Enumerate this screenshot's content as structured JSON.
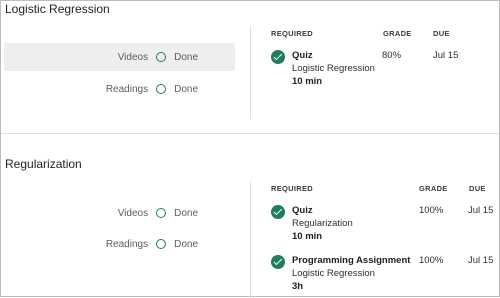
{
  "modules": [
    {
      "title": "Logistic Regression",
      "rows": [
        {
          "label": "Videos",
          "status": "Done",
          "highlight": true
        },
        {
          "label": "Readings",
          "status": "Done",
          "highlight": false
        }
      ],
      "headers": {
        "required": "REQUIRED",
        "grade": "GRADE",
        "due": "DUE"
      },
      "items": [
        {
          "title": "Quiz",
          "subtitle": "Logistic Regression",
          "duration": "10 min",
          "grade": "80%",
          "due": "Jul 15",
          "icon": "check-circle-icon"
        }
      ]
    },
    {
      "title": "Regularization",
      "rows": [
        {
          "label": "Videos",
          "status": "Done",
          "highlight": false
        },
        {
          "label": "Readings",
          "status": "Done",
          "highlight": false
        }
      ],
      "headers": {
        "required": "REQUIRED",
        "grade": "GRADE",
        "due": "DUE"
      },
      "items": [
        {
          "title": "Quiz",
          "subtitle": "Regularization",
          "duration": "10 min",
          "grade": "100%",
          "due": "Jul 15",
          "icon": "check-circle-icon"
        },
        {
          "title": "Programming Assignment",
          "subtitle": "Logistic Regression",
          "duration": "3h",
          "grade": "100%",
          "due": "Jul 15",
          "icon": "check-circle-icon"
        }
      ]
    }
  ],
  "colors": {
    "accent": "#1e7e5d",
    "highlight_bg": "#eeeeee",
    "divider": "#e1e1e1"
  }
}
